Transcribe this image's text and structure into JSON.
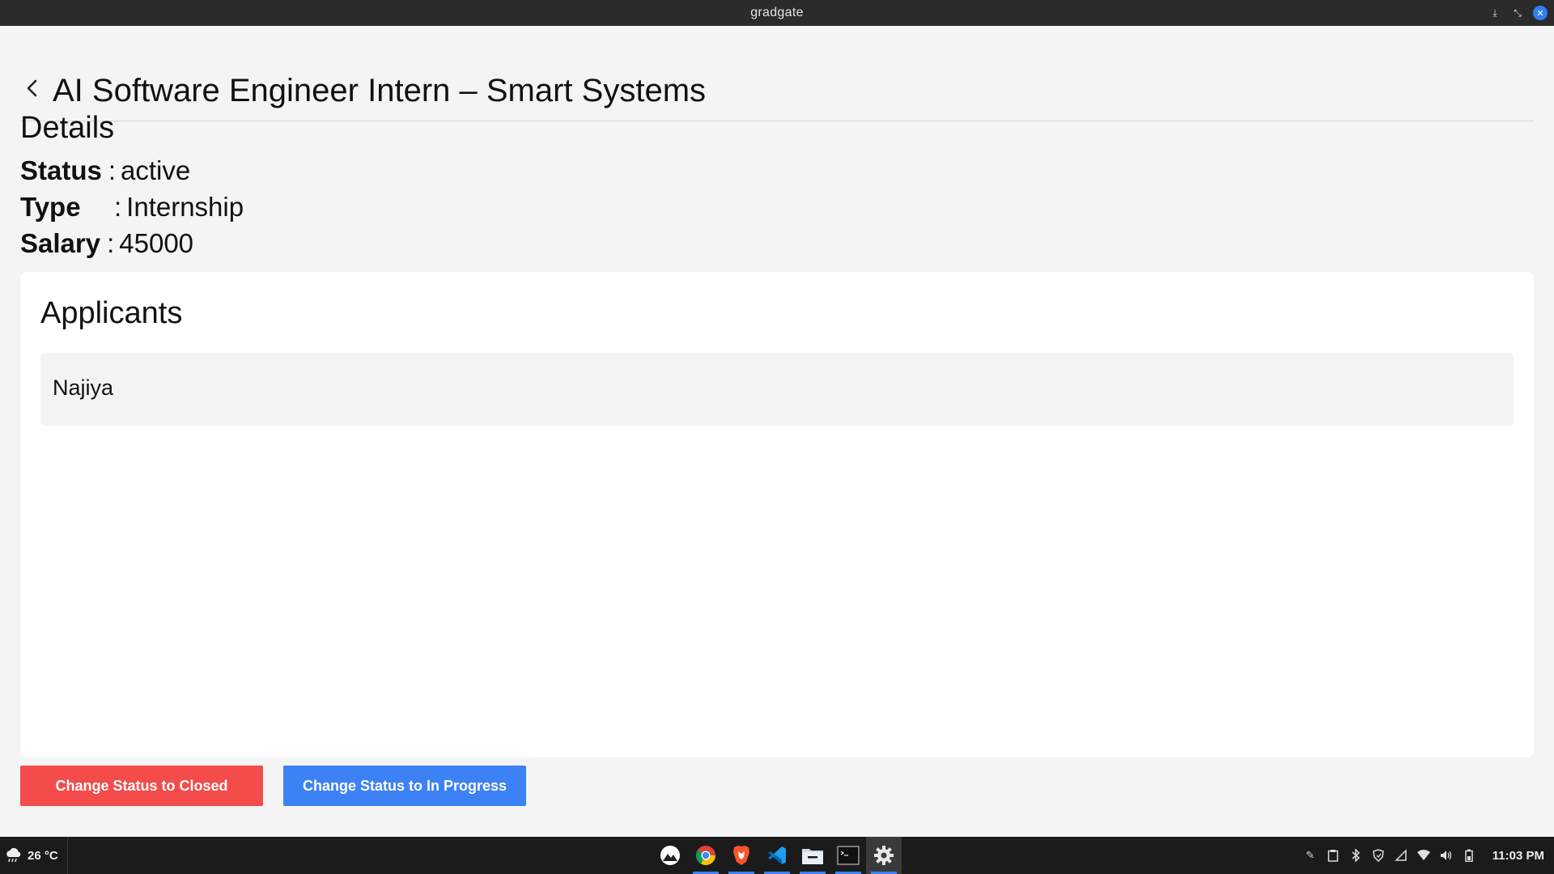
{
  "window": {
    "title": "gradgate",
    "controls": [
      "download-icon",
      "restore-icon",
      "close-icon"
    ]
  },
  "page": {
    "title": "AI Software Engineer Intern – Smart Systems",
    "back_icon": "chevron-left-icon"
  },
  "details": {
    "heading": "Details",
    "status_label": "Status",
    "status_value": "active",
    "type_label": "Type",
    "type_value": "Internship",
    "salary_label": "Salary",
    "salary_value": "45000",
    "separator": ":"
  },
  "applicants": {
    "heading": "Applicants",
    "items": [
      {
        "name": "Najiya"
      }
    ]
  },
  "actions": {
    "close_label": "Change Status to Closed",
    "in_progress_label": "Change Status to In Progress",
    "close_color": "#f44b4b",
    "in_progress_color": "#3d82f5"
  },
  "taskbar": {
    "weather_temp": "26 °C",
    "weather_icon": "cloud-rain-icon",
    "apps": [
      {
        "name": "mountain-app-icon"
      },
      {
        "name": "chrome-icon"
      },
      {
        "name": "brave-icon"
      },
      {
        "name": "vscode-icon"
      },
      {
        "name": "files-icon"
      },
      {
        "name": "terminal-icon"
      },
      {
        "name": "settings-gear-icon"
      }
    ],
    "tray": [
      "pen-icon",
      "clipboard-icon",
      "bluetooth-icon",
      "shield-icon",
      "network-icon",
      "wifi-icon",
      "volume-icon",
      "battery-icon"
    ],
    "clock": "11:03 PM"
  }
}
